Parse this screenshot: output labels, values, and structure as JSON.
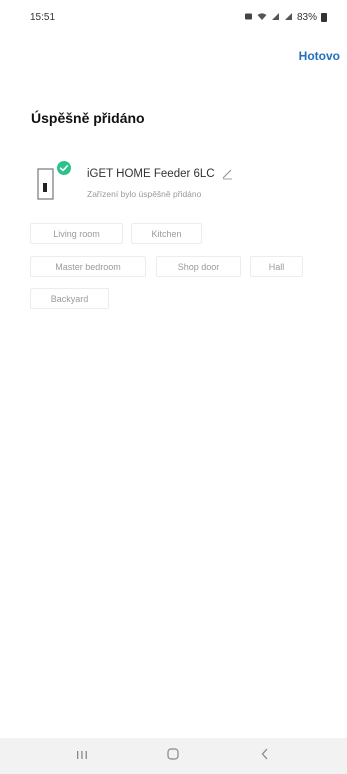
{
  "status_bar": {
    "time": "15:51",
    "battery_text": "83%"
  },
  "header": {
    "done_label": "Hotovo"
  },
  "page": {
    "title": "Úspěšně přidáno"
  },
  "device": {
    "name": "iGET HOME Feeder 6LC",
    "status": "Zařízení bylo úspěšně přidáno"
  },
  "rooms": [
    {
      "label": "Living room"
    },
    {
      "label": "Kitchen"
    },
    {
      "label": "Master bedroom"
    },
    {
      "label": "Shop door"
    },
    {
      "label": "Hall"
    },
    {
      "label": "Backyard"
    }
  ],
  "colors": {
    "accent": "#1f6fbd",
    "success": "#2cc28c",
    "nav_background": "#f2f2f2"
  },
  "icons": {
    "edit": "pencil-icon",
    "success": "check-circle-icon",
    "nav_recent": "recent-apps-icon",
    "nav_home": "home-icon",
    "nav_back": "back-icon"
  }
}
